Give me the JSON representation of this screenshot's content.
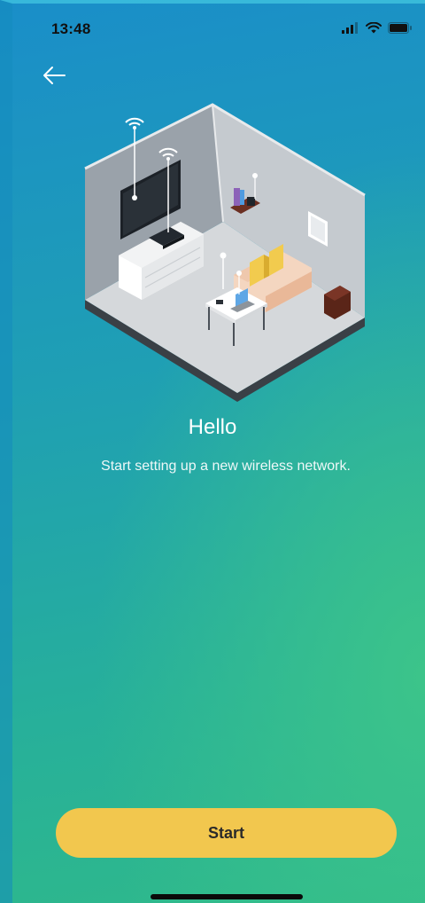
{
  "status_bar": {
    "time": "13:48",
    "icons": [
      "cellular-signal-icon",
      "wifi-icon",
      "battery-icon"
    ]
  },
  "navigation": {
    "back_icon": "arrow-left-icon"
  },
  "illustration": {
    "subject": "isometric-living-room-wifi-illustration"
  },
  "content": {
    "title": "Hello",
    "subtitle": "Start setting up a new wireless network."
  },
  "actions": {
    "start_label": "Start"
  },
  "colors": {
    "background_top": "#1a8ec9",
    "background_bottom": "#2fb98a",
    "button": "#f2c74e",
    "button_text": "#2a2a2a",
    "title_text": "#ffffff"
  }
}
